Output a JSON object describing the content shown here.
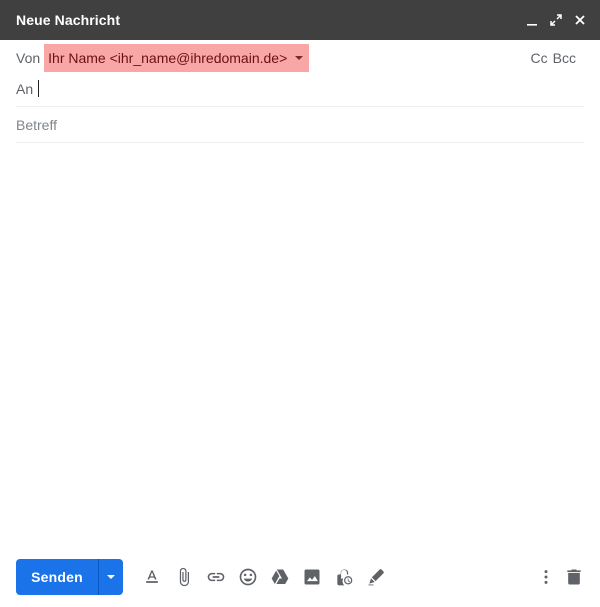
{
  "window": {
    "title": "Neue Nachricht",
    "controls": [
      "minimize-icon",
      "fullscreen-icon",
      "close-icon"
    ]
  },
  "from": {
    "label": "Von",
    "value": "Ihr Name <ihr_name@ihredomain.de>",
    "highlight_color": "#f8a6a6"
  },
  "recipients_links": {
    "cc": "Cc",
    "bcc": "Bcc"
  },
  "to": {
    "label": "An",
    "value": ""
  },
  "subject": {
    "placeholder": "Betreff",
    "value": ""
  },
  "body": {
    "value": ""
  },
  "toolbar": {
    "send_label": "Senden",
    "send_color": "#1a73e8",
    "icons": [
      "format-text-icon",
      "attach-icon",
      "link-icon",
      "emoji-icon",
      "drive-icon",
      "image-icon",
      "confidential-mode-icon",
      "signature-icon"
    ],
    "right_icons": [
      "more-options-icon",
      "trash-icon"
    ]
  },
  "colors": {
    "titlebar": "#404040",
    "icon_gray": "#5f6368"
  }
}
